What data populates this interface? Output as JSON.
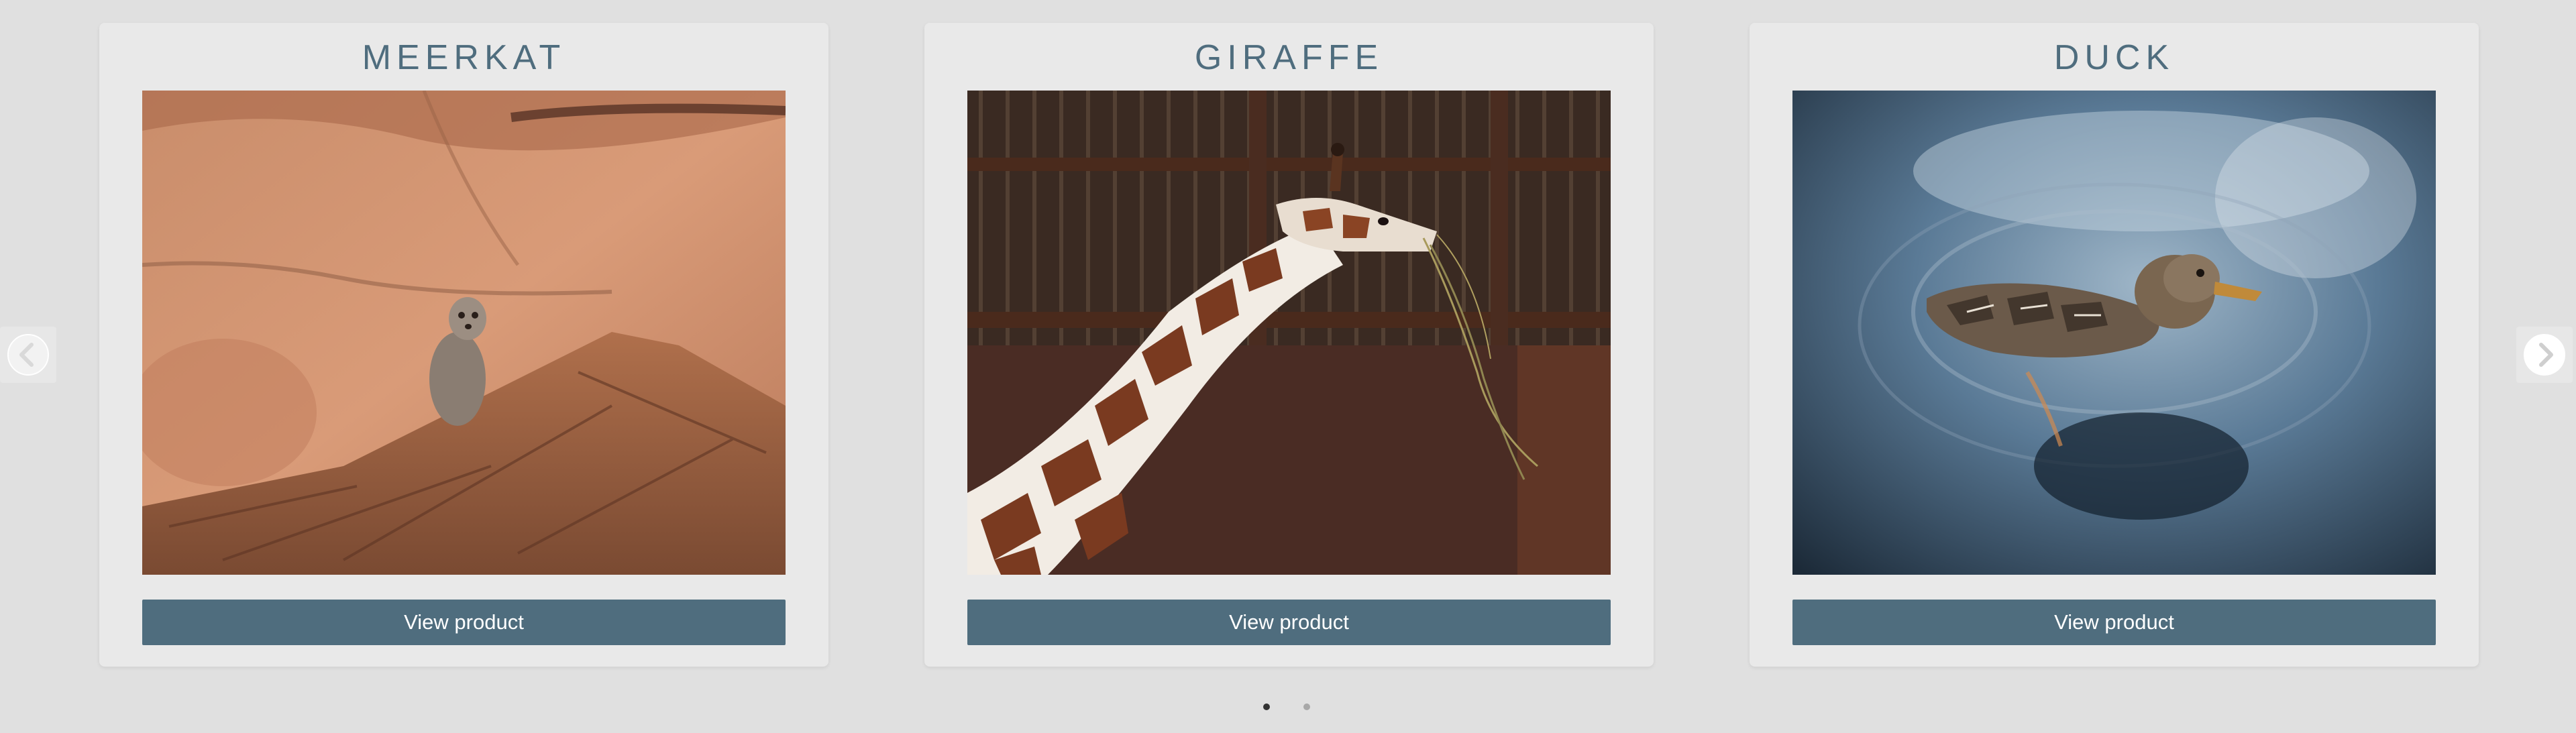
{
  "carousel": {
    "prev_icon": "chevron-left-circle-icon",
    "next_icon": "chevron-right-circle-icon",
    "active_dot": 0,
    "dot_count": 2
  },
  "products": [
    {
      "title": "MEERKAT",
      "image": "meerkat-on-log-photo",
      "button_label": "View product"
    },
    {
      "title": "GIRAFFE",
      "image": "giraffe-eating-hay-photo",
      "button_label": "View product"
    },
    {
      "title": "DUCK",
      "image": "duck-swimming-photo",
      "button_label": "View product"
    }
  ],
  "colors": {
    "background": "#e0e0e0",
    "card": "#e9e9e9",
    "accent": "#4f6d7e",
    "button_text": "#ffffff"
  }
}
